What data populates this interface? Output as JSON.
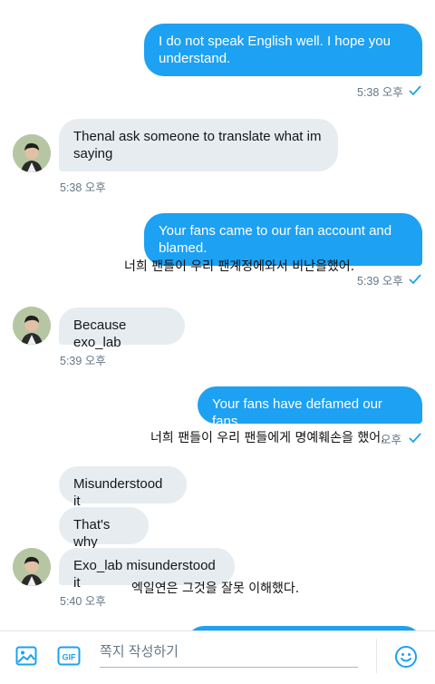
{
  "messages": {
    "m1": {
      "text": "I do not speak English well. I hope you understand.",
      "time": "5:38 오후"
    },
    "m2": {
      "text": "Thenal ask someone to translate what im saying",
      "time": "5:38 오후"
    },
    "m3": {
      "text": "Your fans came to our fan account and blamed.",
      "time": "5:39 오후",
      "translation": "너희 팬들이 우리 팬계정에와서 비난을했어."
    },
    "m4": {
      "text": "Because exo_lab",
      "time": "5:39 오후"
    },
    "m5": {
      "text": "Your fans have defamed our fans.",
      "time": "오후",
      "translation": "너희 팬들이 우리 팬들에게 명예훼손을 했어."
    },
    "m6": {
      "text": "Misunderstood it"
    },
    "m7": {
      "text": "That's why"
    },
    "m8": {
      "text": "Exo_lab misunderstood it",
      "time": "5:40 오후",
      "translation": "엑일연은 그것을 잘못 이해했다."
    }
  },
  "composer": {
    "placeholder": "쪽지 작성하기",
    "gif_label": "GIF",
    "icons": [
      "image-icon",
      "gif-icon",
      "emoji-icon"
    ]
  },
  "colors": {
    "accent": "#1da1f2",
    "received": "#e6ecf0",
    "meta": "#657786"
  }
}
